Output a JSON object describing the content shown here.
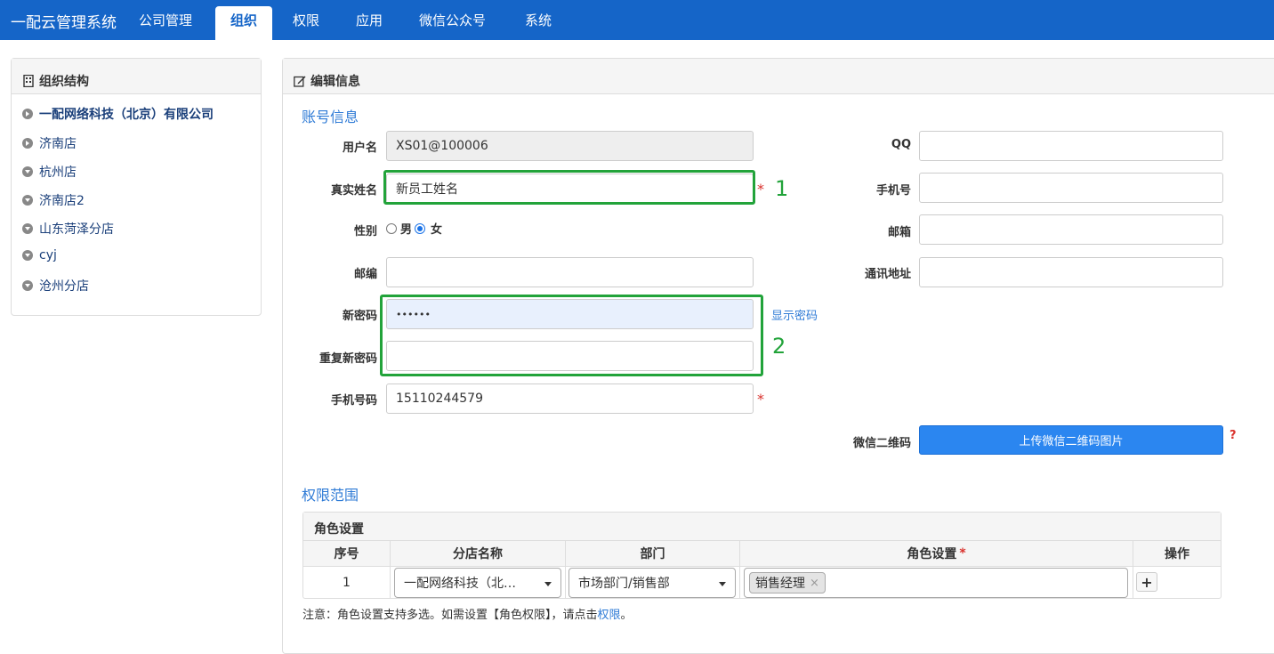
{
  "nav": {
    "brand": "一配云管理系统",
    "tabs": [
      "公司管理",
      "组织",
      "权限",
      "应用",
      "微信公众号",
      "系统"
    ],
    "active": "组织"
  },
  "sidebar": {
    "title": "组织结构",
    "items": [
      "一配网络科技（北京）有限公司",
      "济南店",
      "杭州店",
      "济南店2",
      "山东菏泽分店",
      "cyj",
      "沧州分店"
    ]
  },
  "main": {
    "title": "编辑信息",
    "account_section": "账号信息",
    "fields": {
      "username_label": "用户名",
      "username_value": "XS01@100006",
      "realname_label": "真实姓名",
      "realname_value": "新员工姓名",
      "gender_label": "性别",
      "gender_male": "男",
      "gender_female": "女",
      "gender_selected": "女",
      "zip_label": "邮编",
      "zip_value": "",
      "new_password_label": "新密码",
      "new_password_value": "••••••",
      "show_password": "显示密码",
      "repeat_password_label": "重复新密码",
      "repeat_password_value": "",
      "mobile_label": "手机号码",
      "mobile_value": "15110244579",
      "qq_label": "QQ",
      "phone_label": "手机号",
      "email_label": "邮箱",
      "address_label": "通讯地址",
      "wechat_qr_label": "微信二维码",
      "upload_button": "上传微信二维码图片",
      "help_mark": "?"
    },
    "annotations": {
      "box1": "1",
      "box2": "2"
    },
    "required_mark": "*",
    "permission_section": "权限范围",
    "role_table": {
      "title": "角色设置",
      "headers": [
        "序号",
        "分店名称",
        "部门",
        "角色设置",
        "操作"
      ],
      "row": {
        "index": "1",
        "store": "一配网络科技（北…",
        "department": "市场部门/销售部",
        "role_tag": "销售经理",
        "remove": "×",
        "add": "+"
      }
    },
    "note_prefix": "注意：角色设置支持多选。如需设置【角色权限】，请点击",
    "note_link": "权限",
    "note_suffix": "。"
  }
}
